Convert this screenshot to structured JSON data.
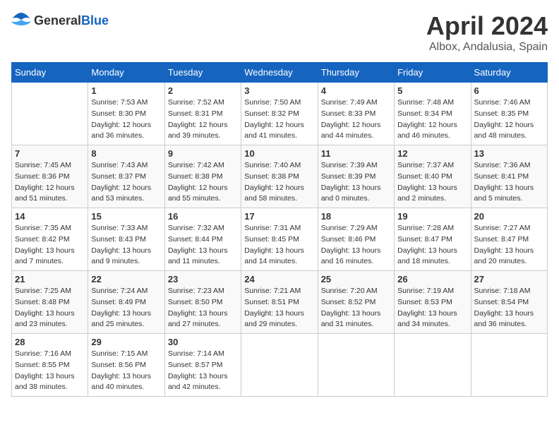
{
  "header": {
    "logo_general": "General",
    "logo_blue": "Blue",
    "month": "April 2024",
    "location": "Albox, Andalusia, Spain"
  },
  "calendar": {
    "days_of_week": [
      "Sunday",
      "Monday",
      "Tuesday",
      "Wednesday",
      "Thursday",
      "Friday",
      "Saturday"
    ],
    "weeks": [
      [
        {
          "day": "",
          "sunrise": "",
          "sunset": "",
          "daylight": ""
        },
        {
          "day": "1",
          "sunrise": "Sunrise: 7:53 AM",
          "sunset": "Sunset: 8:30 PM",
          "daylight": "Daylight: 12 hours and 36 minutes."
        },
        {
          "day": "2",
          "sunrise": "Sunrise: 7:52 AM",
          "sunset": "Sunset: 8:31 PM",
          "daylight": "Daylight: 12 hours and 39 minutes."
        },
        {
          "day": "3",
          "sunrise": "Sunrise: 7:50 AM",
          "sunset": "Sunset: 8:32 PM",
          "daylight": "Daylight: 12 hours and 41 minutes."
        },
        {
          "day": "4",
          "sunrise": "Sunrise: 7:49 AM",
          "sunset": "Sunset: 8:33 PM",
          "daylight": "Daylight: 12 hours and 44 minutes."
        },
        {
          "day": "5",
          "sunrise": "Sunrise: 7:48 AM",
          "sunset": "Sunset: 8:34 PM",
          "daylight": "Daylight: 12 hours and 46 minutes."
        },
        {
          "day": "6",
          "sunrise": "Sunrise: 7:46 AM",
          "sunset": "Sunset: 8:35 PM",
          "daylight": "Daylight: 12 hours and 48 minutes."
        }
      ],
      [
        {
          "day": "7",
          "sunrise": "Sunrise: 7:45 AM",
          "sunset": "Sunset: 8:36 PM",
          "daylight": "Daylight: 12 hours and 51 minutes."
        },
        {
          "day": "8",
          "sunrise": "Sunrise: 7:43 AM",
          "sunset": "Sunset: 8:37 PM",
          "daylight": "Daylight: 12 hours and 53 minutes."
        },
        {
          "day": "9",
          "sunrise": "Sunrise: 7:42 AM",
          "sunset": "Sunset: 8:38 PM",
          "daylight": "Daylight: 12 hours and 55 minutes."
        },
        {
          "day": "10",
          "sunrise": "Sunrise: 7:40 AM",
          "sunset": "Sunset: 8:38 PM",
          "daylight": "Daylight: 12 hours and 58 minutes."
        },
        {
          "day": "11",
          "sunrise": "Sunrise: 7:39 AM",
          "sunset": "Sunset: 8:39 PM",
          "daylight": "Daylight: 13 hours and 0 minutes."
        },
        {
          "day": "12",
          "sunrise": "Sunrise: 7:37 AM",
          "sunset": "Sunset: 8:40 PM",
          "daylight": "Daylight: 13 hours and 2 minutes."
        },
        {
          "day": "13",
          "sunrise": "Sunrise: 7:36 AM",
          "sunset": "Sunset: 8:41 PM",
          "daylight": "Daylight: 13 hours and 5 minutes."
        }
      ],
      [
        {
          "day": "14",
          "sunrise": "Sunrise: 7:35 AM",
          "sunset": "Sunset: 8:42 PM",
          "daylight": "Daylight: 13 hours and 7 minutes."
        },
        {
          "day": "15",
          "sunrise": "Sunrise: 7:33 AM",
          "sunset": "Sunset: 8:43 PM",
          "daylight": "Daylight: 13 hours and 9 minutes."
        },
        {
          "day": "16",
          "sunrise": "Sunrise: 7:32 AM",
          "sunset": "Sunset: 8:44 PM",
          "daylight": "Daylight: 13 hours and 11 minutes."
        },
        {
          "day": "17",
          "sunrise": "Sunrise: 7:31 AM",
          "sunset": "Sunset: 8:45 PM",
          "daylight": "Daylight: 13 hours and 14 minutes."
        },
        {
          "day": "18",
          "sunrise": "Sunrise: 7:29 AM",
          "sunset": "Sunset: 8:46 PM",
          "daylight": "Daylight: 13 hours and 16 minutes."
        },
        {
          "day": "19",
          "sunrise": "Sunrise: 7:28 AM",
          "sunset": "Sunset: 8:47 PM",
          "daylight": "Daylight: 13 hours and 18 minutes."
        },
        {
          "day": "20",
          "sunrise": "Sunrise: 7:27 AM",
          "sunset": "Sunset: 8:47 PM",
          "daylight": "Daylight: 13 hours and 20 minutes."
        }
      ],
      [
        {
          "day": "21",
          "sunrise": "Sunrise: 7:25 AM",
          "sunset": "Sunset: 8:48 PM",
          "daylight": "Daylight: 13 hours and 23 minutes."
        },
        {
          "day": "22",
          "sunrise": "Sunrise: 7:24 AM",
          "sunset": "Sunset: 8:49 PM",
          "daylight": "Daylight: 13 hours and 25 minutes."
        },
        {
          "day": "23",
          "sunrise": "Sunrise: 7:23 AM",
          "sunset": "Sunset: 8:50 PM",
          "daylight": "Daylight: 13 hours and 27 minutes."
        },
        {
          "day": "24",
          "sunrise": "Sunrise: 7:21 AM",
          "sunset": "Sunset: 8:51 PM",
          "daylight": "Daylight: 13 hours and 29 minutes."
        },
        {
          "day": "25",
          "sunrise": "Sunrise: 7:20 AM",
          "sunset": "Sunset: 8:52 PM",
          "daylight": "Daylight: 13 hours and 31 minutes."
        },
        {
          "day": "26",
          "sunrise": "Sunrise: 7:19 AM",
          "sunset": "Sunset: 8:53 PM",
          "daylight": "Daylight: 13 hours and 34 minutes."
        },
        {
          "day": "27",
          "sunrise": "Sunrise: 7:18 AM",
          "sunset": "Sunset: 8:54 PM",
          "daylight": "Daylight: 13 hours and 36 minutes."
        }
      ],
      [
        {
          "day": "28",
          "sunrise": "Sunrise: 7:16 AM",
          "sunset": "Sunset: 8:55 PM",
          "daylight": "Daylight: 13 hours and 38 minutes."
        },
        {
          "day": "29",
          "sunrise": "Sunrise: 7:15 AM",
          "sunset": "Sunset: 8:56 PM",
          "daylight": "Daylight: 13 hours and 40 minutes."
        },
        {
          "day": "30",
          "sunrise": "Sunrise: 7:14 AM",
          "sunset": "Sunset: 8:57 PM",
          "daylight": "Daylight: 13 hours and 42 minutes."
        },
        {
          "day": "",
          "sunrise": "",
          "sunset": "",
          "daylight": ""
        },
        {
          "day": "",
          "sunrise": "",
          "sunset": "",
          "daylight": ""
        },
        {
          "day": "",
          "sunrise": "",
          "sunset": "",
          "daylight": ""
        },
        {
          "day": "",
          "sunrise": "",
          "sunset": "",
          "daylight": ""
        }
      ]
    ]
  }
}
